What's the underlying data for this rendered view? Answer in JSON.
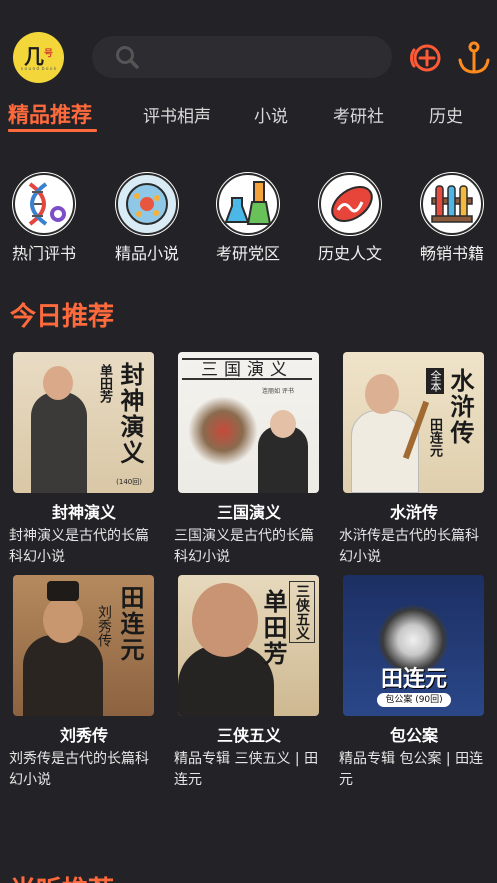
{
  "header": {
    "avatar_text": "几",
    "avatar_sup": "号",
    "avatar_tiny": "ｓｏｕｎｄ ｂｏｏｋ"
  },
  "tabs": [
    "精品推荐",
    "评书相声",
    "小说",
    "考研社",
    "历史"
  ],
  "categories": [
    {
      "label": "热门评书",
      "icon": "dna-icon"
    },
    {
      "label": "精品小说",
      "icon": "cell-icon"
    },
    {
      "label": "考研党区",
      "icon": "flask-icon"
    },
    {
      "label": "历史人文",
      "icon": "organ-icon"
    },
    {
      "label": "畅销书籍",
      "icon": "test-tubes-icon"
    }
  ],
  "section_today": "今日推荐",
  "section_next": "当听推荐",
  "books": [
    {
      "title": "封神演义",
      "desc": "封神演义是古代的长篇科幻小说",
      "cover_caption": "封神演义",
      "cover_author": "单田芳",
      "cover_note": "(140回)"
    },
    {
      "title": "三国演义",
      "desc": "三国演义是古代的长篇科幻小说",
      "cover_caption": "三国演义",
      "cover_author": "连丽如 评书"
    },
    {
      "title": "水浒传",
      "desc": "水浒传是古代的长篇科幻小说",
      "cover_caption": "水浒传",
      "cover_author": "田连元",
      "cover_note": "全本"
    },
    {
      "title": "刘秀传",
      "desc": "刘秀传是古代的长篇科幻小说",
      "cover_caption": "田连元",
      "cover_author": "刘秀传"
    },
    {
      "title": "三侠五义",
      "desc": "精品专辑 三侠五义 | 田连元",
      "cover_caption": "单田芳",
      "cover_author": "三侠五义"
    },
    {
      "title": "包公案",
      "desc": "精品专辑 包公案 | 田连元",
      "cover_caption": "田连元",
      "cover_author": "包公案 (90回)"
    }
  ],
  "colors": {
    "accent": "#ff6a3d",
    "background": "#232327"
  }
}
